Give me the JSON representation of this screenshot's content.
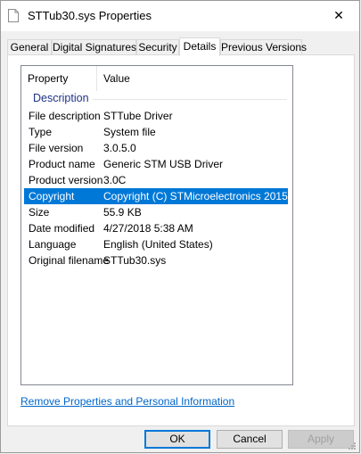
{
  "window": {
    "title": "STTub30.sys Properties",
    "close_symbol": "✕",
    "icon": "file-icon"
  },
  "tabs": [
    {
      "label": "General"
    },
    {
      "label": "Digital Signatures"
    },
    {
      "label": "Security"
    },
    {
      "label": "Details",
      "active": true
    },
    {
      "label": "Previous Versions"
    }
  ],
  "details": {
    "columns": {
      "property": "Property",
      "value": "Value"
    },
    "group": "Description",
    "rows": [
      {
        "property": "File description",
        "value": "STTube Driver"
      },
      {
        "property": "Type",
        "value": "System file"
      },
      {
        "property": "File version",
        "value": "3.0.5.0"
      },
      {
        "property": "Product name",
        "value": "Generic STM USB Driver"
      },
      {
        "property": "Product version",
        "value": "3.0C"
      },
      {
        "property": "Copyright",
        "value": "Copyright (C) STMicroelectronics 2015",
        "selected": true
      },
      {
        "property": "Size",
        "value": "55.9 KB"
      },
      {
        "property": "Date modified",
        "value": "4/27/2018 5:38 AM"
      },
      {
        "property": "Language",
        "value": "English (United States)"
      },
      {
        "property": "Original filename",
        "value": "STTub30.sys"
      }
    ]
  },
  "link": {
    "label": "Remove Properties and Personal Information"
  },
  "buttons": {
    "ok": "OK",
    "cancel": "Cancel",
    "apply": "Apply"
  },
  "colors": {
    "selection": "#0078d7",
    "link": "#0066cc",
    "group_label": "#1e3287"
  }
}
